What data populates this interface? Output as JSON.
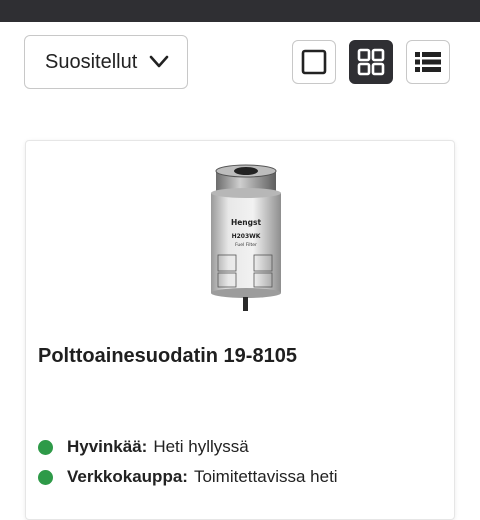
{
  "toolbar": {
    "sort_value": "Suositellut"
  },
  "view_toggle": {
    "active": "grid",
    "options": [
      "single-column",
      "grid",
      "list"
    ]
  },
  "product": {
    "title": "Polttoainesuodatin 19-8105",
    "image_text": {
      "brand": "Hengst",
      "code": "H203WK",
      "type": "Fuel Filter"
    },
    "availability": [
      {
        "location": "Hyvinkää:",
        "status": "Heti hyllyssä"
      },
      {
        "location": "Verkkokauppa:",
        "status": "Toimitettavissa heti"
      }
    ]
  },
  "colors": {
    "topbar": "#2f2f33",
    "active_button": "#2f2f33",
    "in_stock": "#2e9a48"
  }
}
